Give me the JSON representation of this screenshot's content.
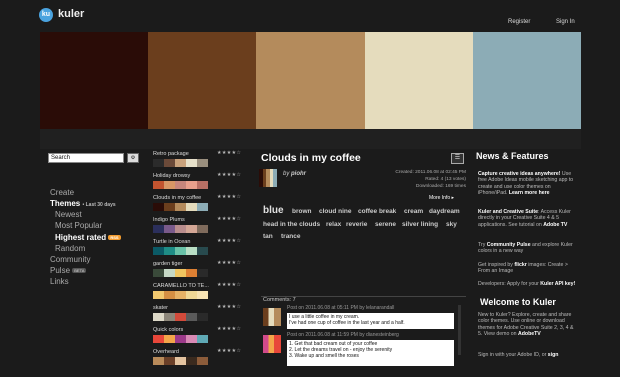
{
  "header": {
    "logo_mark": "ku",
    "app_name": "kuler",
    "register": "Register",
    "sign_in": "Sign In"
  },
  "current_theme_swatches": [
    "#2a0c07",
    "#6b3e1d",
    "#b48b5c",
    "#e5dcbd",
    "#8cacb6"
  ],
  "sidebar": {
    "search_value": "Search",
    "advanced_search_icon": "advanced-search",
    "create": "Create",
    "themes": "Themes",
    "themes_filter": "• Last 30 days",
    "newest": "Newest",
    "most_popular": "Most Popular",
    "highest_rated": "Highest rated",
    "highest_rated_badge": "RSS",
    "random": "Random",
    "community": "Community",
    "pulse": "Pulse",
    "pulse_badge": "BETA",
    "links": "Links"
  },
  "theme_list": [
    {
      "name": "Retro package",
      "stars": "★★★★☆",
      "colors": [
        "#2b2b2b",
        "#6b4a39",
        "#c9a27c",
        "#e7e1cb",
        "#9a8f7e"
      ]
    },
    {
      "name": "Holiday drowsy",
      "stars": "★★★★☆",
      "colors": [
        "#c2542f",
        "#d89766",
        "#c7867c",
        "#e9a08c",
        "#b87065"
      ]
    },
    {
      "name": "Clouds in my coffee",
      "stars": "★★★★☆",
      "colors": [
        "#2a0c07",
        "#6b3e1d",
        "#b48b5c",
        "#e5dcbd",
        "#8cacb6"
      ]
    },
    {
      "name": "Indigo Plums",
      "stars": "★★★★☆",
      "colors": [
        "#2b2f5c",
        "#7a5a8b",
        "#b98d8d",
        "#d4a796",
        "#7f6b5c"
      ]
    },
    {
      "name": "Turtle in Ocean",
      "stars": "★★★★☆",
      "colors": [
        "#0b5a66",
        "#1f8d86",
        "#69c2a8",
        "#b9dfc5",
        "#284a4e"
      ]
    },
    {
      "name": "garden tiger",
      "stars": "★★★★☆",
      "colors": [
        "#3a4a3a",
        "#c5d8c5",
        "#f0c560",
        "#de8033",
        "#2a2a2a"
      ]
    },
    {
      "name": "CARAMELLO TO TE...",
      "stars": "★★★★☆",
      "colors": [
        "#f2c96f",
        "#d58f43",
        "#e6b266",
        "#f0d896",
        "#f7e3b3"
      ]
    },
    {
      "name": "skater",
      "stars": "★★★★☆",
      "colors": [
        "#ddd9c7",
        "#8c8679",
        "#d24a3a",
        "#5a5a5a",
        "#2a2a2a"
      ]
    },
    {
      "name": "Quick colors",
      "stars": "★★★★☆",
      "colors": [
        "#e8473a",
        "#f3a64a",
        "#9d3a8a",
        "#d88ab5",
        "#5fa9b5"
      ]
    },
    {
      "name": "Overheard",
      "stars": "★★★★☆",
      "colors": [
        "#b98b5a",
        "#6b4028",
        "#e4c4a0",
        "#3a2a1e",
        "#8c5c3a"
      ]
    }
  ],
  "detail": {
    "title": "Clouds in my coffee",
    "by_prefix": "by",
    "author": "piohr",
    "created": "Created: 2011.06.08 at 02:45 PM",
    "rated": "Rated: 4 (13 votes)",
    "downloaded": "Downloaded: 169 times",
    "more_info": "More Info ▸",
    "tags": [
      "blue",
      "brown",
      "cloud nine",
      "coffee break",
      "cream",
      "daydream",
      "head in the clouds",
      "relax",
      "reverie",
      "serene",
      "silver lining",
      "sky",
      "tan",
      "trance"
    ]
  },
  "comments": {
    "header": "Comments: 7",
    "items": [
      {
        "meta": "Post on 2011.06.08 at 05:11 PM by lelanarandall",
        "lines": [
          "I use a little coffee in my cream.",
          "I've had one cup of coffee in the last year and a half."
        ]
      },
      {
        "meta": "Post on 2011.06.08 at 11:59 PM by dianesteinberg",
        "lines": [
          "1. Get that bad cream out of your coffee",
          "2. Let the dreams travel on - enjoy the serenity",
          "3. Wake up and smell the roses"
        ]
      }
    ]
  },
  "news": {
    "heading": "News & Features",
    "p1_bold": "Capture creative ideas anywhere!",
    "p1_text": "Use free Adobe Ideas mobile sketching app to create and use color themes on iPhone/iPad.",
    "p1_link": "Learn more here",
    "p2_bold": "Kuler and Creative Suite",
    "p2_text": ": Access Kuler directly in your Creative Suite 4 & 5 applications. See tutorial on",
    "p2_link": "Adobe TV",
    "p3_pre": "Try",
    "p3_link": "Community Pulse",
    "p3_text": "and explore Kuler colors in a new way",
    "p4_pre": "Get inspired by",
    "p4_link": "flickr",
    "p4_text": "images: Create > From an Image",
    "p5_text": "Developers: Apply for your",
    "p5_link": "Kuler API key!",
    "welcome_heading": "Welcome to Kuler",
    "w1_text": "New to Kuler? Explore, create and share color themes. Use online or download themes for Adobe Creative Suite 2, 3, 4 & 5. View demo on",
    "w1_link": "AdobeTV",
    "w2_text": "Sign in with your Adobe ID, or",
    "w2_link": "sign"
  }
}
